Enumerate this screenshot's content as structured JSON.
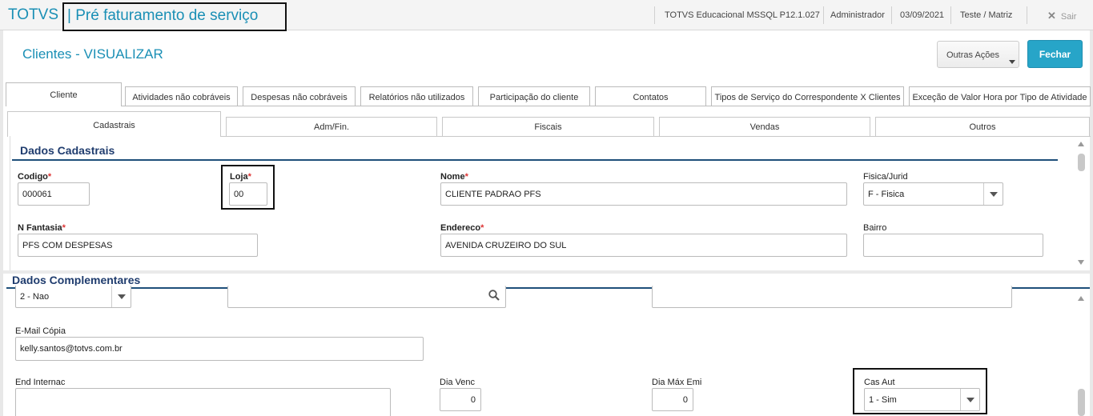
{
  "header": {
    "brand": "TOTVS",
    "separator": "|",
    "module_title": "Pré faturamento de serviço",
    "system": "TOTVS Educacional MSSQL P12.1.027",
    "user": "Administrador",
    "date": "03/09/2021",
    "environment": "Teste / Matriz",
    "exit_label": "Sair",
    "exit_icon": "close-icon"
  },
  "page": {
    "title": "Clientes - VISUALIZAR",
    "other_actions_label": "Outras Ações",
    "close_label": "Fechar"
  },
  "tabs_primary": [
    {
      "label": "Cliente",
      "active": true
    },
    {
      "label": "Atividades não cobráveis"
    },
    {
      "label": "Despesas não cobráveis"
    },
    {
      "label": "Relatórios não utilizados"
    },
    {
      "label": "Participação do cliente"
    },
    {
      "label": "Contatos"
    },
    {
      "label": "Tipos de Serviço do Correspondente X Clientes"
    },
    {
      "label": "Exceção de Valor Hora por Tipo de Atividade"
    }
  ],
  "tabs_secondary": [
    {
      "label": "Cadastrais",
      "active": true
    },
    {
      "label": "Adm/Fin."
    },
    {
      "label": "Fiscais"
    },
    {
      "label": "Vendas"
    },
    {
      "label": "Outros"
    }
  ],
  "dados_cadastrais": {
    "section_title": "Dados Cadastrais",
    "required_mark": "*",
    "codigo": {
      "label": "Codigo",
      "value": "000061"
    },
    "loja": {
      "label": "Loja",
      "value": "00"
    },
    "nome": {
      "label": "Nome",
      "value": "CLIENTE PADRAO PFS"
    },
    "fisica_jurid": {
      "label": "Fisica/Jurid",
      "value": "F - Fisica"
    },
    "n_fantasia": {
      "label": "N Fantasia",
      "value": "PFS COM DESPESAS"
    },
    "endereco": {
      "label": "Endereco",
      "value": "AVENIDA CRUZEIRO DO SUL"
    },
    "bairro": {
      "label": "Bairro",
      "value": ""
    }
  },
  "dados_complementares": {
    "section_title": "Dados Complementares",
    "select_top": {
      "value": "2 - Nao"
    },
    "search_field": {
      "value": "",
      "icon": "search-icon"
    },
    "field_right": {
      "value": ""
    },
    "email_copia": {
      "label": "E-Mail Cópia",
      "value": "kelly.santos@totvs.com.br"
    },
    "end_internac": {
      "label": "End Internac",
      "value": ""
    },
    "dia_venc": {
      "label": "Dia Venc",
      "value": "0"
    },
    "dia_max_emi": {
      "label": "Dia Máx Emi",
      "value": "0"
    },
    "cas_aut": {
      "label": "Cas Aut",
      "value": "1 - Sim"
    }
  }
}
